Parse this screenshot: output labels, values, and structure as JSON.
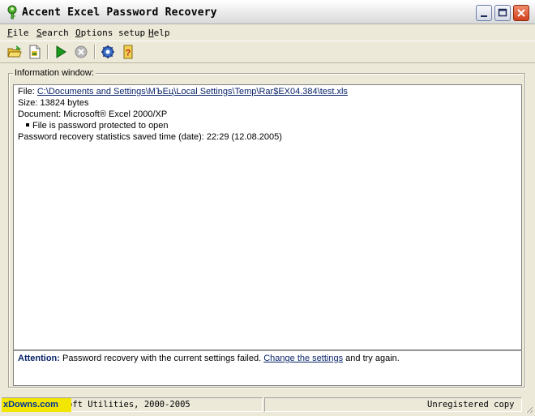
{
  "window": {
    "title": "Accent Excel Password Recovery",
    "buttons": {
      "minimize": "minimize-icon",
      "maximize": "maximize-icon",
      "close": "close-icon"
    }
  },
  "menu": {
    "items": [
      {
        "label_first": "F",
        "label_rest": "ile"
      },
      {
        "label_first": "S",
        "label_rest": "earch"
      },
      {
        "label_first": "O",
        "label_rest": "ptions setup"
      },
      {
        "label_first": "H",
        "label_rest": "elp"
      }
    ]
  },
  "toolbar": {
    "icons": [
      "open-folder-icon",
      "open-file-icon",
      "start-icon",
      "stop-icon",
      "settings-icon",
      "help-icon"
    ]
  },
  "info": {
    "group_label": "Information window:",
    "file_label": "File:",
    "file_path": "C:\\Documents and Settings\\МЪЕц\\Local Settings\\Temp\\Rar$EX04.384\\test.xls",
    "size": "Size: 13824 bytes",
    "document": "Document: Microsoft® Excel 2000/XP",
    "protection": "File is password protected to open",
    "stats": "Password recovery statistics saved time (date): 22:29 (12.08.2005)"
  },
  "attention": {
    "label": "Attention:",
    "text_before": "Password recovery with the current settings failed.",
    "link": "Change the settings",
    "text_after": "and try again."
  },
  "status": {
    "left": "oft Utilities, 2000-2005",
    "right": "Unregistered copy",
    "watermark": "xDowns.com"
  },
  "colors": {
    "link": "#0a246a",
    "watermark_bg": "#f2e600",
    "watermark_fg": "#003399",
    "start_green": "#1c9a1c"
  }
}
